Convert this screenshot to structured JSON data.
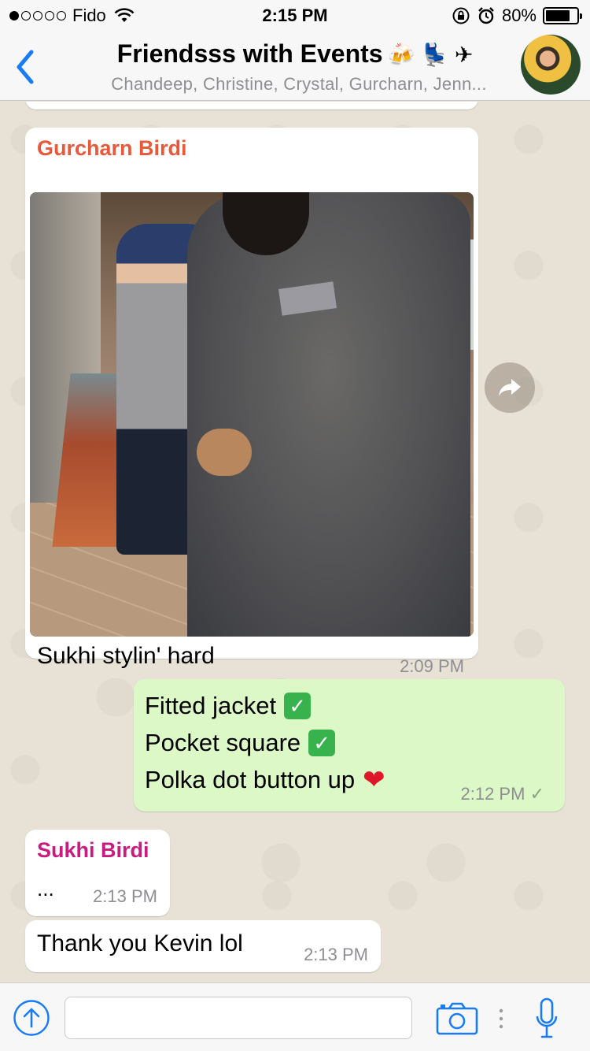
{
  "status_bar": {
    "carrier": "Fido",
    "time": "2:15 PM",
    "battery": "80%",
    "signal_bars_filled": 1,
    "signal_bars_total": 5,
    "battery_level": 0.8
  },
  "header": {
    "title": "Friendsss with Events",
    "title_emojis": "🍻 💺 ✈",
    "subtitle": "Chandeep, Christine, Crystal, Gurcharn, Jenn..."
  },
  "messages": [
    {
      "sender": "Gurcharn Birdi",
      "sender_color": "#e8583b",
      "caption": "Sukhi stylin' hard",
      "time": "2:09 PM"
    },
    {
      "lines": [
        "Fitted jacket",
        "Pocket square",
        "Polka dot button up"
      ],
      "time": "2:12 PM",
      "status": "sent"
    },
    {
      "sender": "Sukhi Birdi",
      "sender_color": "#c81d7e",
      "text": "...",
      "time": "2:13 PM"
    },
    {
      "text": "Thank you Kevin lol",
      "time": "2:13 PM"
    }
  ],
  "input": {
    "value": "",
    "placeholder": ""
  },
  "colors": {
    "accent": "#1a7cf4",
    "outgoing_bubble": "#dcf8c6",
    "incoming_bubble": "#ffffff",
    "chat_bg": "#e7e1d6"
  }
}
